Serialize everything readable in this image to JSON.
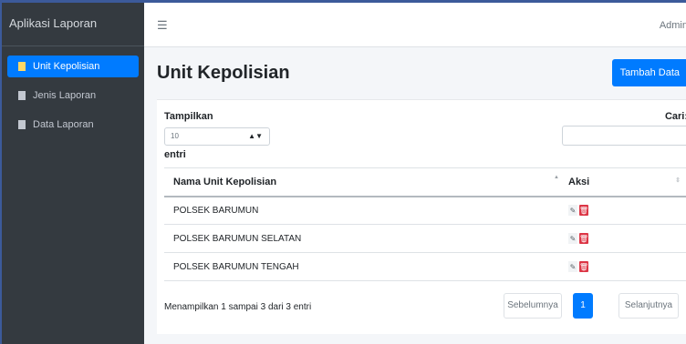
{
  "sidebar": {
    "brand": "Aplikasi Laporan",
    "items": [
      {
        "label": "Unit Kepolisian",
        "active": true
      },
      {
        "label": "Jenis Laporan",
        "active": false
      },
      {
        "label": "Data Laporan",
        "active": false
      }
    ]
  },
  "topbar": {
    "menu_icon": "hamburger-icon",
    "user": "Admin"
  },
  "main": {
    "title": "Unit Kepolisian",
    "add_button": "Tambah Data"
  },
  "table_controls": {
    "show_label": "Tampilkan",
    "page_size": "10",
    "entries_label": "entri",
    "search_label": "Cari:",
    "search_value": ""
  },
  "table": {
    "columns": [
      "Nama Unit Kepolisian",
      "Aksi"
    ],
    "rows": [
      {
        "name": "POLSEK BARUMUN"
      },
      {
        "name": "POLSEK BARUMUN SELATAN"
      },
      {
        "name": "POLSEK BARUMUN TENGAH"
      }
    ]
  },
  "footer": {
    "info": "Menampilkan 1 sampai 3 dari 3 entri",
    "prev": "Sebelumnya",
    "page": "1",
    "next": "Selanjutnya"
  },
  "colors": {
    "sidebar_bg": "#343a40",
    "primary": "#007bff",
    "danger": "#dc3545"
  }
}
